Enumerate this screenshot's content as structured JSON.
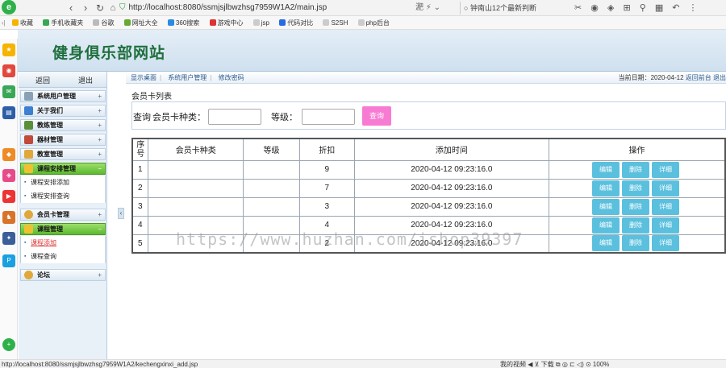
{
  "browser": {
    "logo": "e",
    "url": "http://localhost:8080/ssmjsjlbwzhsg7959W1A2/main.jsp",
    "addr_icons": "淝 ⚡ ⌄",
    "search_text": "钟南山12个最新判断",
    "right_icons": "✂ ◉ ◈ ⊞ ⚲ ▦ ↶ ⋮",
    "bookmarks": [
      "收藏",
      "手机收藏夹",
      "谷歌",
      "网址大全",
      "360搜索",
      "游戏中心",
      "jsp",
      "代码对比",
      "S2SH",
      "php后台"
    ],
    "status_url": "http://localhost:8080/ssmjsjlbwzhsg7959W1A2/kechengxinxi_add.jsp",
    "status_right": "我的视频  ◀  ⊻  下载  ⧉  ◎  ⊏  ◁)  ⊙  100%"
  },
  "app": {
    "title": "健身俱乐部网站",
    "menu_buttons": {
      "back": "返回",
      "logout": "退出"
    },
    "menu": [
      {
        "label": "系统用户管理",
        "toggle": "+"
      },
      {
        "label": "关于我们",
        "toggle": "+"
      },
      {
        "label": "教练管理",
        "toggle": "+"
      },
      {
        "label": "器材管理",
        "toggle": "+"
      },
      {
        "label": "教室管理",
        "toggle": "+"
      },
      {
        "label": "课程安排管理",
        "toggle": "−",
        "subitems": [
          "课程安排添加",
          "课程安排查询"
        ]
      },
      {
        "label": "会员卡管理",
        "toggle": "+"
      },
      {
        "label": "课程管理",
        "toggle": "−",
        "subitems": [
          "课程添加",
          "课程查询"
        ]
      },
      {
        "label": "论坛",
        "toggle": "+"
      }
    ],
    "collapse_arrow": "‹"
  },
  "topnav": {
    "links": [
      "显示桌面",
      "系统用户管理",
      "修改密码"
    ],
    "date_label": "当前日期：2020-04-12",
    "date_links": [
      "返回前台",
      "退出"
    ]
  },
  "page": {
    "label": "会员卡列表",
    "search": {
      "prefix": "查询",
      "field1_label": "会员卡种类：",
      "field2_label": "等级：",
      "button": "查询"
    },
    "table": {
      "headers": [
        "序号",
        "会员卡种类",
        "等级",
        "折扣",
        "添加时间",
        "操作"
      ],
      "rows": [
        [
          "1",
          "",
          "",
          "9",
          "2020-04-12 09:23:16.0"
        ],
        [
          "2",
          "",
          "",
          "7",
          "2020-04-12 09:23:16.0"
        ],
        [
          "3",
          "",
          "",
          "3",
          "2020-04-12 09:23:16.0"
        ],
        [
          "4",
          "",
          "",
          "4",
          "2020-04-12 09:23:16.0"
        ],
        [
          "5",
          "",
          "",
          "2",
          "2020-04-12 09:23:16.0"
        ]
      ],
      "actions": [
        "编辑",
        "删除",
        "详细"
      ]
    }
  },
  "watermark": "https://www.huzhan.com/ishop39397",
  "colors": {
    "title_green": "#1f6f3d",
    "active_menu": "#5cb82e",
    "search_button": "#f77bd3",
    "action_button": "#5bc0de"
  }
}
